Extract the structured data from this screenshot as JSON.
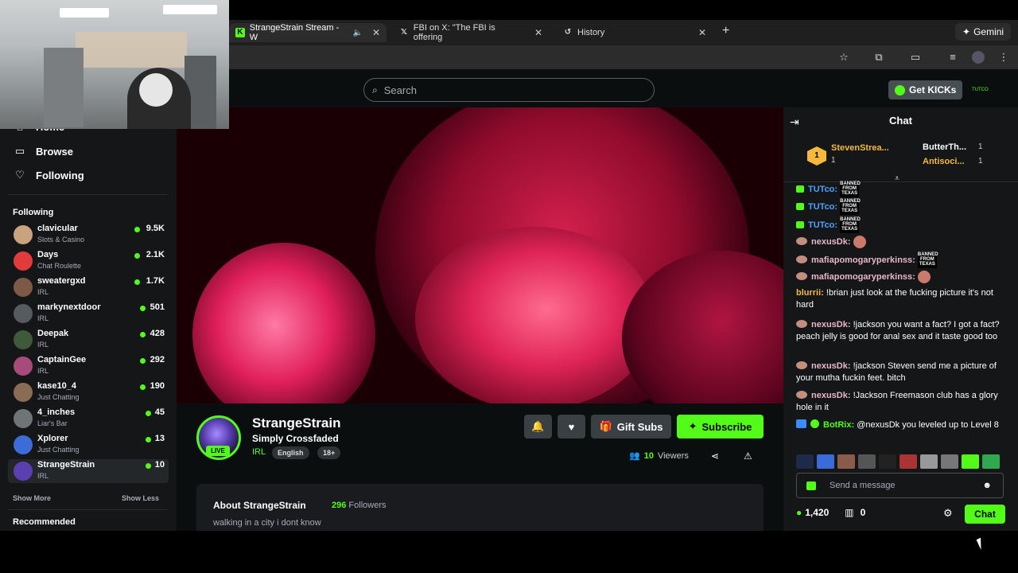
{
  "browser": {
    "tabs": [
      {
        "title": "StrangeStrain Stream - W",
        "icon": "kick-icon",
        "active": true
      },
      {
        "title": "FBI on X: \"The FBI is offering",
        "icon": "x-icon",
        "active": false
      },
      {
        "title": "History",
        "icon": "history-icon",
        "active": false
      }
    ],
    "gemini_label": "Gemini"
  },
  "header": {
    "search_placeholder": "Search",
    "get_kicks_label": "Get KICKs",
    "user_badge": "TUTCO"
  },
  "sidebar": {
    "nav": [
      {
        "label": "Home",
        "icon": "home-icon"
      },
      {
        "label": "Browse",
        "icon": "browse-icon"
      },
      {
        "label": "Following",
        "icon": "heart-icon"
      }
    ],
    "following_heading": "Following",
    "channels": [
      {
        "name": "clavicular",
        "category": "Slots & Casino",
        "viewers": "9.5K",
        "avatar_color": "#c9a27e"
      },
      {
        "name": "Days",
        "category": "Chat Roulette",
        "viewers": "2.1K",
        "avatar_color": "#e23b3b"
      },
      {
        "name": "sweatergxd",
        "category": "IRL",
        "viewers": "1.7K",
        "avatar_color": "#7c5a45"
      },
      {
        "name": "markynextdoor",
        "category": "IRL",
        "viewers": "501",
        "avatar_color": "#555b60"
      },
      {
        "name": "Deepak",
        "category": "IRL",
        "viewers": "428",
        "avatar_color": "#3f5a3a"
      },
      {
        "name": "CaptainGee",
        "category": "IRL",
        "viewers": "292",
        "avatar_color": "#a74c7a"
      },
      {
        "name": "kase10_4",
        "category": "Just Chatting",
        "viewers": "190",
        "avatar_color": "#8a6b54"
      },
      {
        "name": "4_inches",
        "category": "Liar's Bar",
        "viewers": "45",
        "avatar_color": "#6f7477"
      },
      {
        "name": "Xplorer",
        "category": "Just Chatting",
        "viewers": "13",
        "avatar_color": "#3b6cd8"
      },
      {
        "name": "StrangeStrain",
        "category": "IRL",
        "viewers": "10",
        "avatar_color": "#5a3fb0"
      }
    ],
    "show_more": "Show More",
    "show_less": "Show Less",
    "recommended_heading": "Recommended"
  },
  "stream": {
    "name": "StrangeStrain",
    "title": "Simply Crossfaded",
    "category": "IRL",
    "tags": [
      "English",
      "18+"
    ],
    "live_label": "LIVE",
    "gift_subs_label": "Gift Subs",
    "subscribe_label": "Subscribe",
    "viewers_count": "10",
    "viewers_label": "Viewers",
    "about_title": "About StrangeStrain",
    "followers_count": "296",
    "followers_label": "Followers",
    "bio": "walking in a city i dont know"
  },
  "chat": {
    "title": "Chat",
    "pinned": [
      {
        "name": "StevenStrea...",
        "count": "1"
      },
      {
        "name": "ButterTh...",
        "count": "1"
      },
      {
        "name": "Antisoci...",
        "count": "1"
      }
    ],
    "rank_number": "1",
    "messages": [
      {
        "user": "TUTco",
        "text": "",
        "badge": "gem",
        "color": "#4aa3ff",
        "emote": "BANNED FROM TEXAS"
      },
      {
        "user": "TUTco",
        "text": "",
        "badge": "gem",
        "color": "#4aa3ff",
        "emote": "BANNED FROM TEXAS"
      },
      {
        "user": "TUTco",
        "text": "",
        "badge": "gem",
        "color": "#4aa3ff",
        "emote": "BANNED FROM TEXAS"
      },
      {
        "user": "nexusDk",
        "text": "",
        "badge": "av",
        "color": "#e9b7c9",
        "emote": ""
      },
      {
        "user": "mafiapomogaryperkinss",
        "text": "",
        "badge": "av",
        "color": "#e9b7c9",
        "emote": "BANNED FROM TEXAS"
      },
      {
        "user": "mafiapomogaryperkinss",
        "text": "",
        "badge": "av",
        "color": "#e9b7c9",
        "emote": ""
      },
      {
        "user": "blurrii",
        "text": "!brian just look at the fucking picture it's not hard",
        "badge": "",
        "color": "#f6b93b",
        "emote": ""
      },
      {
        "user": "nexusDk",
        "text": "!jackson you want a fact? I got a fact? peach jelly is good for anal sex and it taste good too",
        "badge": "av",
        "color": "#e9b7c9",
        "emote": ""
      },
      {
        "user": "nexusDk",
        "text": "!jackson Steven send me a picture of your mutha fuckin feet. bitch",
        "badge": "av",
        "color": "#e9b7c9",
        "emote": ""
      },
      {
        "user": "nexusDk",
        "text": "!Jackson Freemason club has a glory hole in it",
        "badge": "av",
        "color": "#e9b7c9",
        "emote": ""
      },
      {
        "user": "BotRix",
        "text": "@nexusDk you leveled up to Level 8",
        "badge": "bot",
        "color": "#53fc18",
        "emote": ""
      }
    ],
    "input_placeholder": "Send a message",
    "points": "1,420",
    "store_count": "0",
    "chat_button": "Chat"
  }
}
